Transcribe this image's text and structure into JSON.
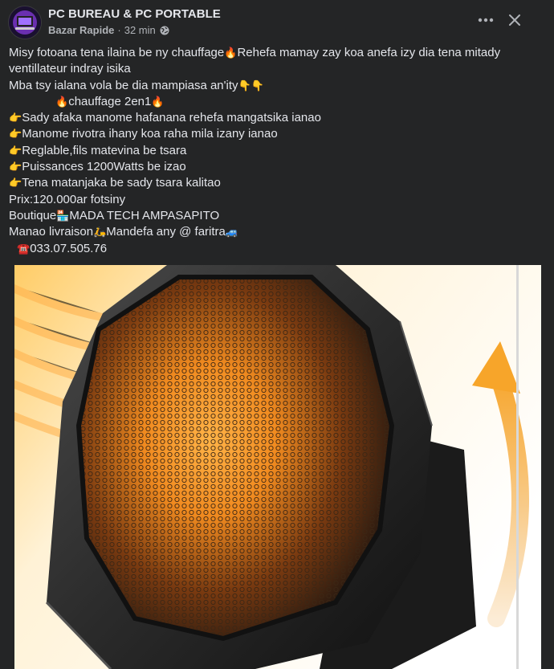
{
  "post": {
    "page_name": "PC BUREAU & PC PORTABLE",
    "group_name": "Bazar Rapide",
    "separator": "·",
    "time": "32 min",
    "privacy_icon": "globe-icon",
    "more_icon": "more-horizontal-icon",
    "close_icon": "close-icon",
    "lines": {
      "l1a": "Misy fotoana tena ilaina be ny chauffage",
      "l1b": "Rehefa mamay zay koa anefa izy dia tena mitady ventillateur indray isika",
      "l2": "Mba tsy ialana vola be dia mampiasa an'ity",
      "l3": "chauffage 2en1",
      "l4": "Sady afaka manome hafanana rehefa mangatsika ianao",
      "l5": "Manome rivotra ihany koa raha mila izany ianao",
      "l6": "Reglable,fils matevina be tsara",
      "l7": "Puissances 1200Watts be izao",
      "l8": "Tena matanjaka be sady tsara kalitao",
      "l9": "Prix:120.000ar fotsiny",
      "l10a": "Boutique",
      "l10b": "MADA TECH AMPASAPITO",
      "l11a": "Manao livraison",
      "l11b": "Mandefa any @ faritra",
      "l12": "033.07.505.76"
    },
    "image_alt": "Heater product photo"
  }
}
